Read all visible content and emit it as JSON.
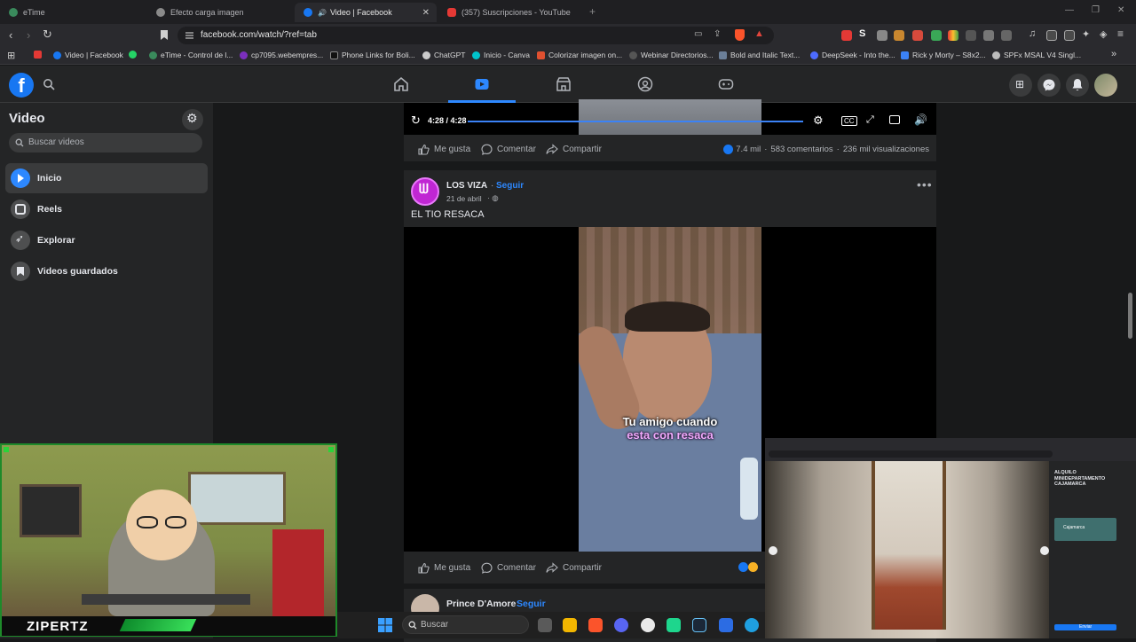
{
  "browser": {
    "tabs": [
      {
        "title": "eTime",
        "color": "#3a8a5c"
      },
      {
        "title": "Efecto carga imagen",
        "color": "#8a8a8a"
      },
      {
        "title": "Video | Facebook",
        "color": "#1877f2"
      },
      {
        "title": "(357) Suscripciones - YouTube",
        "color": "#e53935"
      }
    ],
    "new_tab": "+",
    "url": "facebook.com/watch/?ref=tab",
    "bookmarks": [
      {
        "label": "",
        "color": "#e53935"
      },
      {
        "label": "Video | Facebook",
        "color": "#1877f2"
      },
      {
        "label": "",
        "color": "#25d366"
      },
      {
        "label": "eTime - Control de l...",
        "color": "#3a8a5c"
      },
      {
        "label": "cp7095.webempres...",
        "color": "#7b2fbe"
      },
      {
        "label": "Phone Links for Boli...",
        "color": "#222222"
      },
      {
        "label": "ChatGPT",
        "color": "#cccccc"
      },
      {
        "label": "Inicio - Canva",
        "color": "#00c4cc"
      },
      {
        "label": "Colorizar imagen on...",
        "color": "#e05030"
      },
      {
        "label": "Webinar Directorios...",
        "color": "#888888"
      },
      {
        "label": "Bold and Italic Text...",
        "color": "#6b7f99"
      },
      {
        "label": "DeepSeek - Into the...",
        "color": "#4d6bfe"
      },
      {
        "label": "Rick y Morty – S8x2...",
        "color": "#3b82f6"
      },
      {
        "label": "SPFx MSAL V4 Singl...",
        "color": "#bbbbbb"
      }
    ]
  },
  "sidebar": {
    "title": "Video",
    "search_placeholder": "Buscar videos",
    "items": [
      {
        "label": "Inicio",
        "icon": "play-icon"
      },
      {
        "label": "Reels",
        "icon": "reels-icon"
      },
      {
        "label": "Explorar",
        "icon": "rocket-icon"
      },
      {
        "label": "Videos guardados",
        "icon": "bookmark-icon"
      }
    ]
  },
  "feed": {
    "post1": {
      "time": "4:28 / 4:28",
      "progress": 1.0,
      "like": "Me gusta",
      "comment": "Comentar",
      "share": "Compartir",
      "reactions": "7.4 mil",
      "comments": "583 comentarios",
      "views": "236 mil visualizaciones"
    },
    "post2": {
      "author": "LOS VIZA",
      "follow": "Seguir",
      "date": "21 de abril",
      "caption": "EL TIO RESACA",
      "subtitle_line1": "Tu amigo cuando",
      "subtitle_line2": "esta con resaca",
      "like": "Me gusta",
      "comment": "Comentar",
      "share": "Compartir"
    },
    "post3": {
      "author": "Prince D'Amore",
      "follow": "Seguir"
    }
  },
  "webcam": {
    "label": "ZIPERTZ"
  },
  "pip": {
    "title_line1": "ALQUILO",
    "title_line2": "MINIDEPARTAMENTO",
    "title_line3": "CAJAMARCA",
    "map_label": "Cajamarca",
    "send_label": "Enviar"
  },
  "taskbar": {
    "search_placeholder": "Buscar"
  }
}
